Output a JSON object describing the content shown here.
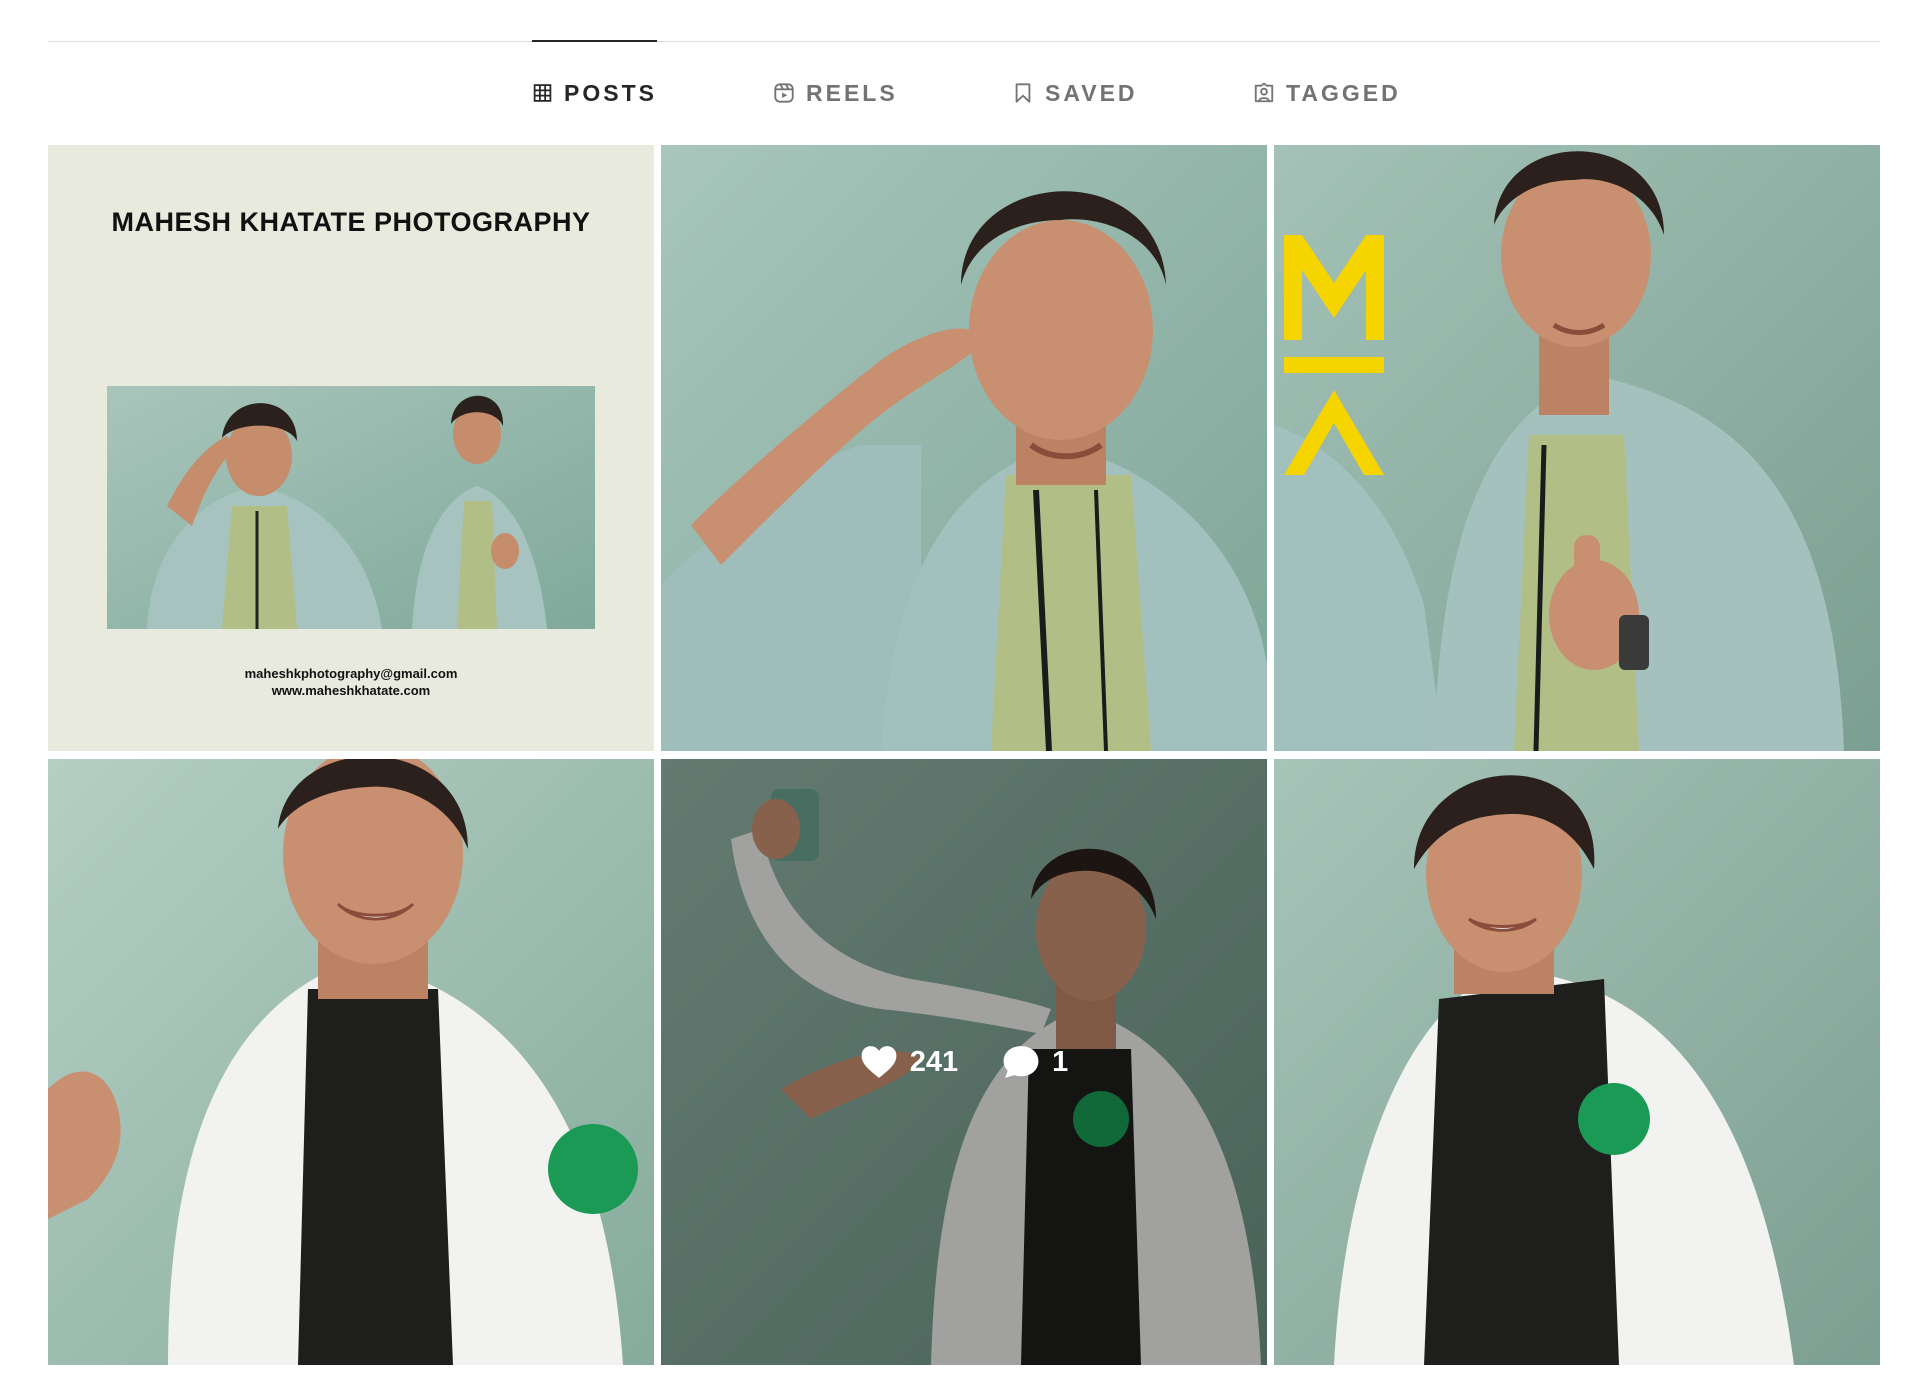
{
  "tabs": [
    {
      "label": "POSTS",
      "icon": "grid-icon",
      "active": true
    },
    {
      "label": "REELS",
      "icon": "reels-icon",
      "active": false
    },
    {
      "label": "SAVED",
      "icon": "bookmark-icon",
      "active": false
    },
    {
      "label": "TAGGED",
      "icon": "tagged-person-icon",
      "active": false
    }
  ],
  "posts": [
    {
      "type": "card",
      "title": "MAHESH KHATATE  PHOTOGRAPHY",
      "email": "maheshkphotography@gmail.com",
      "website": "www.maheshkhatate.com"
    },
    {
      "type": "photo",
      "description_icon": "salute-portrait-image"
    },
    {
      "type": "photo",
      "logo_text": "MA",
      "logo_color": "#f5d400"
    },
    {
      "type": "photo",
      "description_icon": "smiling-portrait-image"
    },
    {
      "type": "photo",
      "hovered": true,
      "likes": "241",
      "comments": "1"
    },
    {
      "type": "photo",
      "description_icon": "portrait-image"
    }
  ],
  "colors": {
    "active_tab": "#262626",
    "inactive_tab": "#737373",
    "divider": "#dbdbdb",
    "card_background": "#e9eade",
    "photo_background": "#8fb3a6",
    "logo_yellow": "#f5d400",
    "brand_green": "#1a9a55"
  }
}
